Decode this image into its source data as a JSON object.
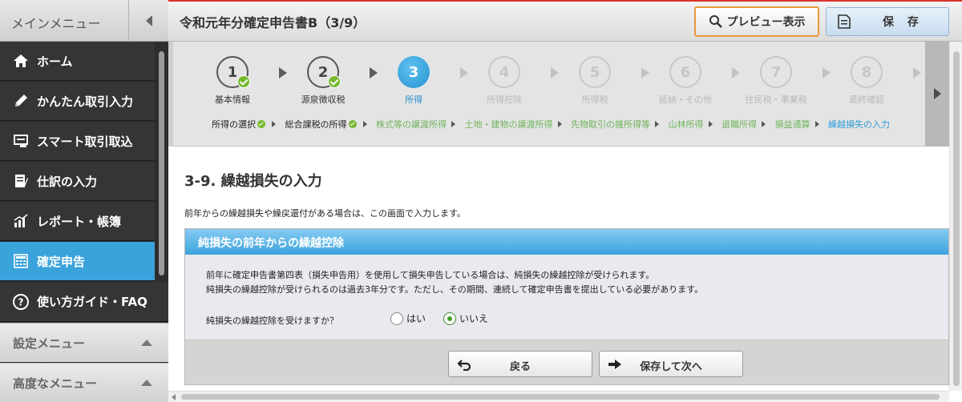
{
  "sidebar": {
    "header": "メインメニュー",
    "items": [
      {
        "label": "ホーム",
        "icon": "home-icon"
      },
      {
        "label": "かんたん取引入力",
        "icon": "pencil-icon"
      },
      {
        "label": "スマート取引取込",
        "icon": "import-icon"
      },
      {
        "label": "仕訳の入力",
        "icon": "journal-icon"
      },
      {
        "label": "レポート・帳簿",
        "icon": "report-chart-icon"
      },
      {
        "label": "確定申告",
        "icon": "calculator-icon"
      },
      {
        "label": "使い方ガイド・FAQ",
        "icon": "help-icon"
      }
    ],
    "settings_menu": "設定メニュー",
    "advanced_menu": "高度なメニュー"
  },
  "header": {
    "title": "令和元年分確定申告書B（3/9）",
    "preview_label": "プレビュー表示",
    "save_label": "保 存"
  },
  "wizard": {
    "steps": [
      {
        "num": "1",
        "label": "基本情報",
        "state": "done"
      },
      {
        "num": "2",
        "label": "源泉徴収税",
        "state": "done"
      },
      {
        "num": "3",
        "label": "所得",
        "state": "current"
      },
      {
        "num": "4",
        "label": "所得控除",
        "state": "todo"
      },
      {
        "num": "5",
        "label": "所得税",
        "state": "todo"
      },
      {
        "num": "6",
        "label": "延納・その他",
        "state": "todo"
      },
      {
        "num": "7",
        "label": "住民税・事業税",
        "state": "todo"
      },
      {
        "num": "8",
        "label": "最終確認",
        "state": "todo"
      }
    ],
    "substeps": [
      {
        "label": "所得の選択",
        "state": "done"
      },
      {
        "label": "総合課税の所得",
        "state": "done"
      },
      {
        "label": "株式等の譲渡所得",
        "state": "todo"
      },
      {
        "label": "土地・建物の譲渡所得",
        "state": "todo"
      },
      {
        "label": "先物取引の雑所得等",
        "state": "todo"
      },
      {
        "label": "山林所得",
        "state": "todo"
      },
      {
        "label": "退職所得",
        "state": "todo"
      },
      {
        "label": "損益通算",
        "state": "todo"
      },
      {
        "label": "繰越損失の入力",
        "state": "current"
      }
    ]
  },
  "content": {
    "title": "3-9. 繰越損失の入力",
    "intro": "前年からの繰越損失や繰戻還付がある場合は、この画面で入力します。",
    "panel": {
      "header": "純損失の前年からの繰越控除",
      "line1": "前年に確定申告書第四表（損失申告用）を使用して損失申告している場合は、純損失の繰越控除が受けられます。",
      "line2": "純損失の繰越控除が受けられるのは過去3年分です。ただし、その期間、連続して確定申告書を提出している必要があります。",
      "question": "純損失の繰越控除を受けますか？",
      "option_yes": "はい",
      "option_no": "いいえ",
      "selected": "いいえ"
    },
    "back_label": "戻る",
    "next_label": "保存して次へ"
  }
}
